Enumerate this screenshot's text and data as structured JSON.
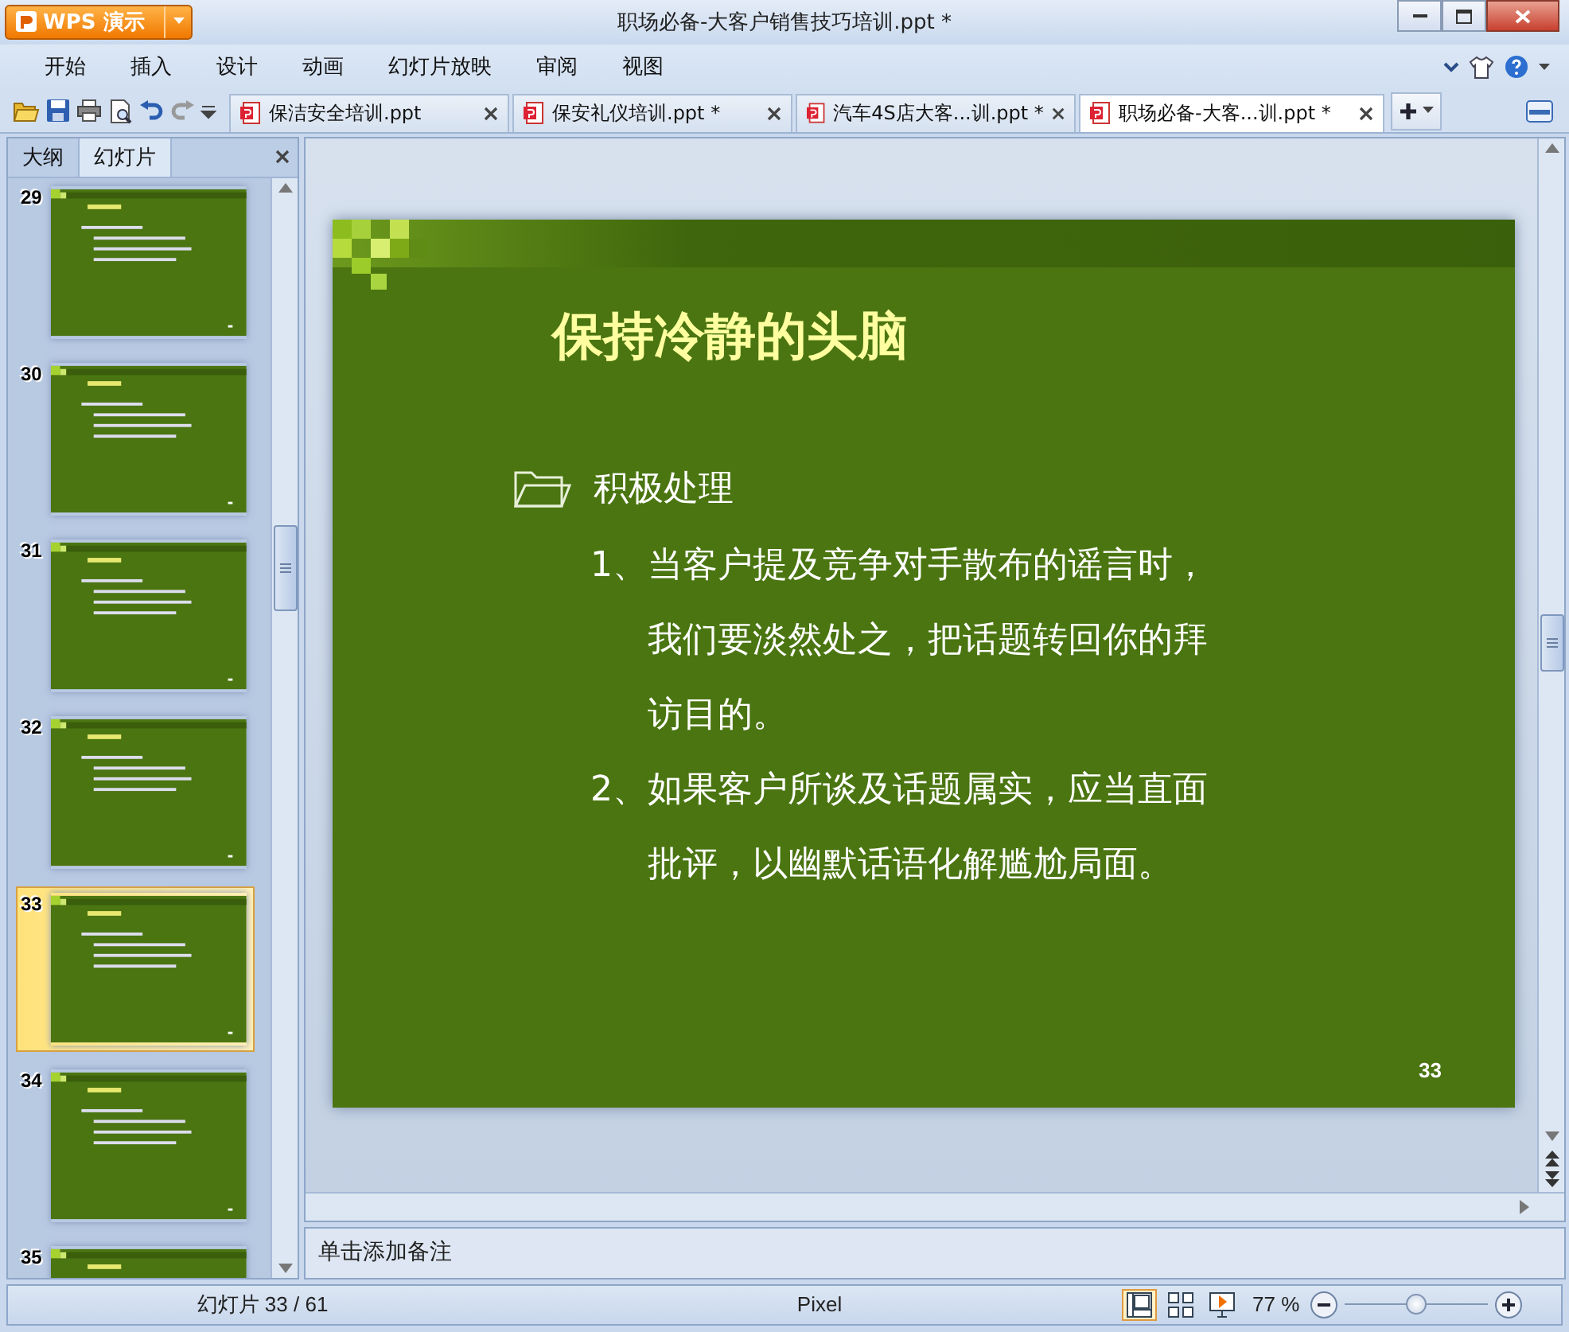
{
  "app": {
    "logo": "WPS 演示"
  },
  "window": {
    "title": "职场必备-大客户销售技巧培训.ppt *"
  },
  "menu": [
    "开始",
    "插入",
    "设计",
    "动画",
    "幻灯片放映",
    "审阅",
    "视图"
  ],
  "doc_tabs": [
    {
      "label": "保洁安全培训.ppt",
      "selected": false
    },
    {
      "label": "保安礼仪培训.ppt *",
      "selected": false
    },
    {
      "label": "汽车4S店大客...训.ppt *",
      "selected": false
    },
    {
      "label": "职场必备-大客...训.ppt *",
      "selected": true
    }
  ],
  "panel_tabs": [
    {
      "label": "大纲",
      "selected": false
    },
    {
      "label": "幻灯片",
      "selected": true
    }
  ],
  "thumbnails": [
    {
      "number": "29",
      "selected": false
    },
    {
      "number": "30",
      "selected": false
    },
    {
      "number": "31",
      "selected": false
    },
    {
      "number": "32",
      "selected": false
    },
    {
      "number": "33",
      "selected": true
    },
    {
      "number": "34",
      "selected": false
    },
    {
      "number": "35",
      "selected": false
    }
  ],
  "slide": {
    "title": "保持冷静的头脑",
    "heading": "积极处理",
    "items": [
      {
        "number": "1、",
        "text": "当客户提及竞争对手散布的谣言时，我们要淡然处之，把话题转回你的拜访目的。"
      },
      {
        "number": "2、",
        "text": "如果客户所谈及话题属实，应当直面批评，以幽默话语化解尴尬局面。"
      }
    ],
    "page_number": "33"
  },
  "notes": {
    "placeholder": "单击添加备注"
  },
  "status_bar": {
    "slide_count": "幻灯片 33 / 61",
    "theme": "Pixel",
    "views": [
      {
        "kind": "normal",
        "selected": true
      },
      {
        "kind": "sorter",
        "selected": false
      },
      {
        "kind": "show",
        "selected": false
      }
    ],
    "zoom": "77 %",
    "zoom_slider": {
      "level": 0.5
    }
  }
}
